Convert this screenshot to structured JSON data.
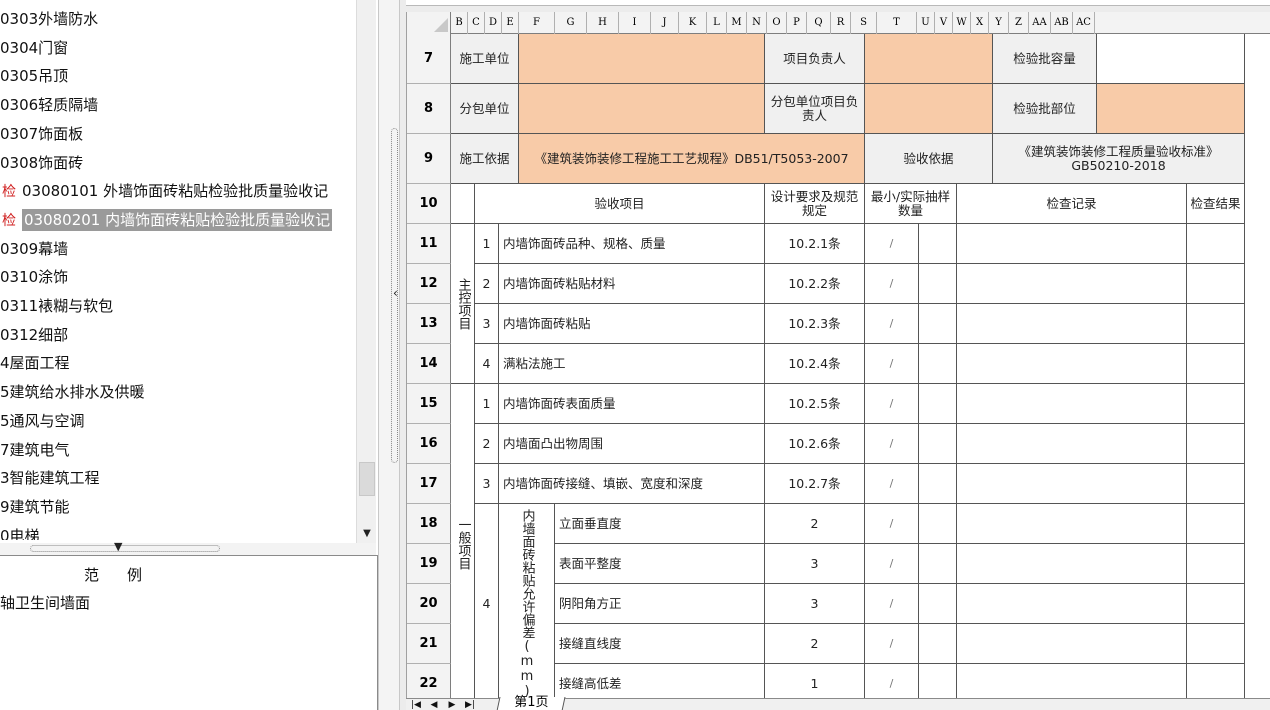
{
  "tree": {
    "items": [
      {
        "label": "0303外墙防水"
      },
      {
        "label": "0304门窗"
      },
      {
        "label": "0305吊顶"
      },
      {
        "label": "0306轻质隔墙"
      },
      {
        "label": "0307饰面板"
      },
      {
        "label": "0308饰面砖"
      },
      {
        "mark": "检",
        "label": "03080101 外墙饰面砖粘贴检验批质量验收记"
      },
      {
        "mark": "检",
        "label": "03080201 内墙饰面砖粘贴检验批质量验收记"
      },
      {
        "label": "0309幕墙"
      },
      {
        "label": "0310涂饰"
      },
      {
        "label": "0311裱糊与软包"
      },
      {
        "label": "0312细部"
      },
      {
        "label": "4屋面工程"
      },
      {
        "label": "5建筑给水排水及供暖"
      },
      {
        "label": "5通风与空调"
      },
      {
        "label": "7建筑电气"
      },
      {
        "label": "3智能建筑工程"
      },
      {
        "label": "9建筑节能"
      },
      {
        "label": "0电梯"
      }
    ]
  },
  "legend": {
    "title": "范例",
    "item": "轴卫生间墙面"
  },
  "columns": [
    "B",
    "C",
    "D",
    "E",
    "F",
    "G",
    "H",
    "I",
    "J",
    "K",
    "L",
    "M",
    "N",
    "O",
    "P",
    "Q",
    "R",
    "S",
    "T",
    "U",
    "V",
    "W",
    "X",
    "Y",
    "Z",
    "AA",
    "AB",
    "AC"
  ],
  "rows": [
    "7",
    "8",
    "9",
    "10",
    "11",
    "12",
    "13",
    "14",
    "15",
    "16",
    "17",
    "18",
    "19",
    "20",
    "21",
    "22"
  ],
  "form": {
    "r7": {
      "label1": "施工单位",
      "label2": "项目负责人",
      "label3": "检验批容量"
    },
    "r8": {
      "label1": "分包单位",
      "label2": "分包单位项目负责人",
      "label3": "检验批部位"
    },
    "r9": {
      "label1": "施工依据",
      "basis": "《建筑装饰装修工程施工工艺规程》DB51/T5053-2007",
      "label2": "验收依据",
      "standard": "《建筑装饰装修工程质量验收标准》GB50210-2018"
    },
    "r10": {
      "item": "验收项目",
      "design": "设计要求及规范规定",
      "sample": "最小/实际抽样数量",
      "record": "检查记录",
      "result": "检查结果"
    },
    "main_group": "主控项目",
    "general_group": "一般项目",
    "main_items": [
      {
        "no": "1",
        "name": "内墙饰面砖品种、规格、质量",
        "clause": "10.2.1条"
      },
      {
        "no": "2",
        "name": "内墙饰面砖粘贴材料",
        "clause": "10.2.2条"
      },
      {
        "no": "3",
        "name": "内墙饰面砖粘贴",
        "clause": "10.2.3条"
      },
      {
        "no": "4",
        "name": "满粘法施工",
        "clause": "10.2.4条"
      }
    ],
    "general_items": [
      {
        "no": "1",
        "name": "内墙饰面砖表面质量",
        "clause": "10.2.5条"
      },
      {
        "no": "2",
        "name": "内墙面凸出物周围",
        "clause": "10.2.6条"
      },
      {
        "no": "3",
        "name": "内墙饰面砖接缝、填嵌、宽度和深度",
        "clause": "10.2.7条"
      }
    ],
    "tolerance_no": "4",
    "tolerance_label": "内墙面砖粘贴允许偏差(mm)",
    "tolerance_items": [
      {
        "name": "立面垂直度",
        "value": "2"
      },
      {
        "name": "表面平整度",
        "value": "3"
      },
      {
        "name": "阴阳角方正",
        "value": "3"
      },
      {
        "name": "接缝直线度",
        "value": "2"
      },
      {
        "name": "接缝高低差",
        "value": "1"
      }
    ],
    "slash": "/"
  },
  "sheet_tab": "第1页",
  "colors": {
    "peach": "#f8cba8",
    "selected": "#9a9a9a"
  }
}
